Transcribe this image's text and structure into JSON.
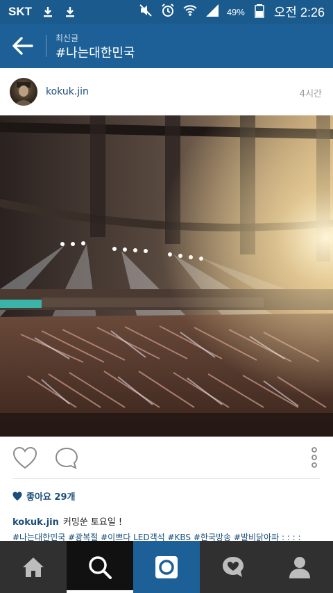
{
  "status_bar": {
    "carrier": "SKT",
    "battery_percent": "49%",
    "time": "오전 2:26",
    "icons": [
      "download-icon",
      "download-icon",
      "mute-icon",
      "alarm-icon",
      "wifi-icon",
      "signal-icon",
      "battery-icon"
    ]
  },
  "header": {
    "subtitle": "최신글",
    "title": "#나는대한민국",
    "back_icon": "arrow-left-icon"
  },
  "post": {
    "username": "kokuk.jin",
    "time_ago": "4시간",
    "likes": "좋아요 29개",
    "caption_user": "kokuk.jin",
    "caption_text": "커밍쑨 토요일 !",
    "hashtags": "#나는대한민국 #광복절 #이쁘다 LED객석 #KBS #한국방송 #발비닭아파 : : : :"
  },
  "actions": {
    "like_icon": "heart-icon",
    "comment_icon": "comment-icon",
    "more_icon": "more-vertical-icon"
  },
  "nav": {
    "items": [
      "home-icon",
      "search-icon",
      "camera-icon",
      "activity-icon",
      "profile-icon"
    ]
  },
  "colors": {
    "statusbar": "#1a5a8c",
    "appbar": "#1d6097",
    "link": "#1b4e7a",
    "nav_bg": "#303030"
  }
}
